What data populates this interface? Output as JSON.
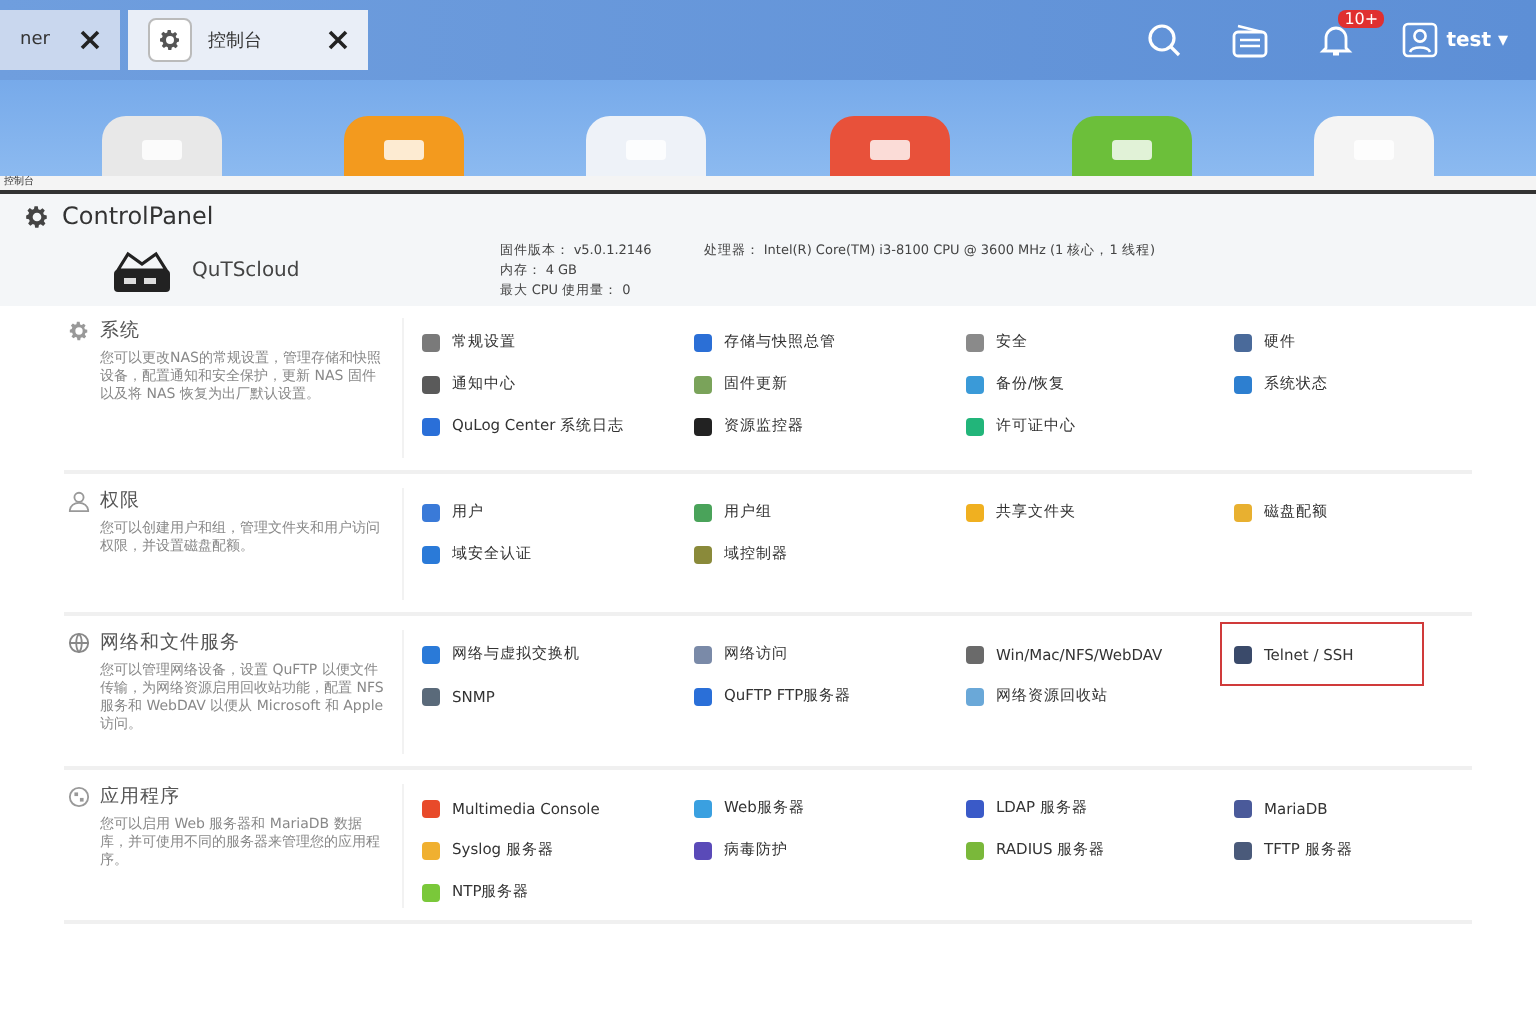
{
  "tabs": [
    {
      "label": "ner",
      "selected": false
    },
    {
      "label": "控制台",
      "selected": true
    }
  ],
  "topbar": {
    "notification_badge": "10+",
    "user": "test",
    "user_caret": "▾"
  },
  "dock": [
    {
      "color": "#e8e8e8"
    },
    {
      "color": "#f39a1e"
    },
    {
      "color": "#eef2f8"
    },
    {
      "color": "#e8513a"
    },
    {
      "color": "#6cbf3a"
    },
    {
      "color": "#f4f4f4"
    }
  ],
  "strip_label": "控制台",
  "panel": {
    "title": "ControlPanel",
    "device": "QuTScloud",
    "info": [
      [
        "固件版本： v5.0.1.2146",
        "处理器： Intel(R) Core(TM) i3-8100 CPU @ 3600 MHz (1 核心，1 线程)"
      ],
      [
        "内存： 4 GB"
      ],
      [
        "最大 CPU 使用量： 0"
      ]
    ],
    "sections": [
      {
        "title": "系统",
        "kind": "gear",
        "desc": "您可以更改NAS的常规设置，管理存储和快照设备，配置通知和安全保护，更新 NAS 固件以及将 NAS 恢复为出厂默认设置。",
        "items": [
          {
            "label": "常规设置",
            "color": "#7a7a7a",
            "highlighted": false
          },
          {
            "label": "存储与快照总管",
            "color": "#2b6fd6",
            "highlighted": false
          },
          {
            "label": "安全",
            "color": "#8a8a8a",
            "highlighted": false
          },
          {
            "label": "硬件",
            "color": "#4a6a9a",
            "highlighted": false
          },
          {
            "label": "通知中心",
            "color": "#5a5a5a",
            "highlighted": false
          },
          {
            "label": "固件更新",
            "color": "#7aa35a",
            "highlighted": false
          },
          {
            "label": "备份/恢复",
            "color": "#3a9ad8",
            "highlighted": false
          },
          {
            "label": "系统状态",
            "color": "#2d7fd0",
            "highlighted": false
          },
          {
            "label": "QuLog Center 系统日志",
            "color": "#2a6fd8",
            "highlighted": false
          },
          {
            "label": "资源监控器",
            "color": "#222222",
            "highlighted": false
          },
          {
            "label": "许可证中心",
            "color": "#22b57a",
            "highlighted": false
          }
        ]
      },
      {
        "title": "权限",
        "kind": "user",
        "desc": "您可以创建用户和组，管理文件夹和用户访问权限，并设置磁盘配额。",
        "items": [
          {
            "label": "用户",
            "color": "#3a7ad8",
            "highlighted": false
          },
          {
            "label": "用户组",
            "color": "#4aa35a",
            "highlighted": false
          },
          {
            "label": "共享文件夹",
            "color": "#f0b020",
            "highlighted": false
          },
          {
            "label": "磁盘配额",
            "color": "#e8b030",
            "highlighted": false
          },
          {
            "label": "域安全认证",
            "color": "#2a7ad8",
            "highlighted": false
          },
          {
            "label": "域控制器",
            "color": "#8a8a3a",
            "highlighted": false
          }
        ]
      },
      {
        "title": "网络和文件服务",
        "kind": "globe",
        "desc": "您可以管理网络设备，设置 QuFTP 以便文件传输，为网络资源启用回收站功能，配置 NFS 服务和 WebDAV 以便从 Microsoft 和 Apple 访问。",
        "items": [
          {
            "label": "网络与虚拟交换机",
            "color": "#2a7ad8",
            "highlighted": false
          },
          {
            "label": "网络访问",
            "color": "#7a8aa8",
            "highlighted": false
          },
          {
            "label": "Win/Mac/NFS/WebDAV",
            "color": "#6a6a6a",
            "highlighted": false
          },
          {
            "label": "Telnet / SSH",
            "color": "#3a4a6a",
            "highlighted": true
          },
          {
            "label": "SNMP",
            "color": "#5a6a7a",
            "highlighted": false
          },
          {
            "label": "QuFTP FTP服务器",
            "color": "#2a6fd8",
            "highlighted": false
          },
          {
            "label": "网络资源回收站",
            "color": "#6aa8d8",
            "highlighted": false
          }
        ]
      },
      {
        "title": "应用程序",
        "kind": "apps",
        "desc": "您可以启用 Web 服务器和 MariaDB 数据库，并可使用不同的服务器来管理您的应用程序。",
        "items": [
          {
            "label": "Multimedia Console",
            "color": "#e84a2a",
            "highlighted": false
          },
          {
            "label": "Web服务器",
            "color": "#3aa0e0",
            "highlighted": false
          },
          {
            "label": "LDAP 服务器",
            "color": "#3a5ac8",
            "highlighted": false
          },
          {
            "label": "MariaDB",
            "color": "#4a5a9a",
            "highlighted": false
          },
          {
            "label": "Syslog 服务器",
            "color": "#f0b030",
            "highlighted": false
          },
          {
            "label": "病毒防护",
            "color": "#5a4ab8",
            "highlighted": false
          },
          {
            "label": "RADIUS 服务器",
            "color": "#7ab83a",
            "highlighted": false
          },
          {
            "label": "TFTP 服务器",
            "color": "#4a5a7a",
            "highlighted": false
          },
          {
            "label": "NTP服务器",
            "color": "#7ac83a",
            "highlighted": false
          }
        ]
      }
    ]
  }
}
